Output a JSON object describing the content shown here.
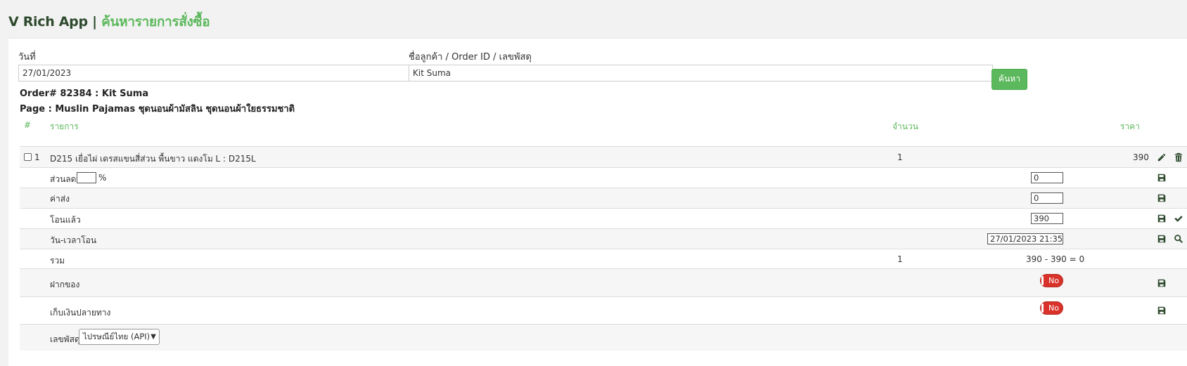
{
  "header": {
    "app_name": "V Rich App",
    "separator": "|",
    "page_title": "ค้นหารายการสั่งซื้อ"
  },
  "search": {
    "date_label": "วันที่",
    "date_value": "27/01/2023",
    "query_label": "ชื่อลูกค้า / Order ID / เลขพัสดุ",
    "query_value": "Kit Suma",
    "button_label": "ค้นหา"
  },
  "order": {
    "order_line": "Order# 82384 : Kit Suma",
    "page_line": "Page : Muslin Pajamas ชุดนอนผ้ามัสลิน ชุดนอนผ้าใยธรรมชาติ"
  },
  "table": {
    "col_num": "#",
    "col_item": "รายการ",
    "col_qty": "จำนวน",
    "col_price": "ราคา",
    "item": {
      "num": "1",
      "name": "D215 เยื่อไผ่ เดรสแขนสี่ส่วน พื้นขาว แดงโม L : D215L",
      "qty": "1",
      "price": "390"
    },
    "discount": {
      "label": "ส่วนลด",
      "value": "",
      "unit": "%",
      "amount": "0"
    },
    "shipping": {
      "label": "ค่าส่ง",
      "value": "0"
    },
    "transferred": {
      "label": "โอนแล้ว",
      "value": "390"
    },
    "transfer_time": {
      "label": "วัน-เวลาโอน",
      "value": "27/01/2023 21:35"
    },
    "total": {
      "label": "รวม",
      "qty": "1",
      "value": "390 - 390 = 0"
    },
    "deposit": {
      "label": "ฝากของ",
      "toggle": "No"
    },
    "cod": {
      "label": "เก็บเงินปลายทาง",
      "toggle": "No"
    },
    "tracking": {
      "label": "เลขพัสดุ",
      "selected": "ไปรษณีย์ไทย (API)"
    }
  },
  "colors": {
    "accent": "#5cb85c",
    "title_dark": "#2e4a2e",
    "toggle_off": "#d9322a"
  },
  "icons": [
    "pencil-icon",
    "trash-icon",
    "save-icon",
    "check-icon",
    "search-icon",
    "chevron-down-icon"
  ]
}
